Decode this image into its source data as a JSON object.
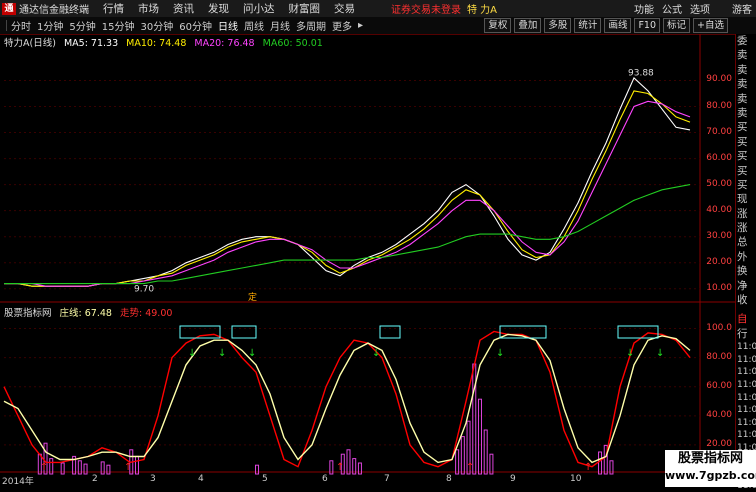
{
  "titlebar": {
    "app_title": "通达信金融终端",
    "menu": [
      "行情",
      "市场",
      "资讯",
      "发现",
      "问小达",
      "财富圈",
      "交易"
    ],
    "status": "证券交易未登录",
    "stock_name": "特 力A",
    "right_menu": [
      "功能",
      "公式",
      "选项",
      "游客"
    ]
  },
  "toolbar": {
    "periods": [
      "分时",
      "1分钟",
      "5分钟",
      "15分钟",
      "30分钟",
      "60分钟",
      "日线",
      "周线",
      "月线",
      "多周期",
      "更多"
    ],
    "active_period": "日线",
    "right_buttons": [
      "复权",
      "叠加",
      "多股",
      "统计",
      "画线",
      "F10",
      "标记",
      "+自选"
    ]
  },
  "main_chart": {
    "legend": {
      "name": "特力A(日线)",
      "ma5": "MA5: 71.33",
      "ma10": "MA10: 74.48",
      "ma20": "MA20: 76.48",
      "ma60": "MA60: 50.01"
    },
    "price_high_label": "93.88",
    "price_low_label": "9.70",
    "marker_label": "定",
    "y_ticks": [
      "90.00",
      "80.00",
      "70.00",
      "60.00",
      "50.00",
      "40.00",
      "30.00",
      "20.00",
      "10.00"
    ],
    "ylim": [
      8,
      104
    ]
  },
  "sub_chart": {
    "legend": {
      "name": "股票指标网",
      "zhuangxian": "庄线: 67.48",
      "zoushi": "走势: 49.00"
    },
    "y_ticks": [
      "100.0",
      "80.00",
      "60.00",
      "40.00",
      "20.00"
    ],
    "ylim": [
      0,
      110
    ]
  },
  "x_axis": {
    "labels": [
      "2014年",
      "2",
      "3",
      "4",
      "5",
      "6",
      "7",
      "8",
      "9",
      "10"
    ]
  },
  "right_panel": {
    "items": [
      "委比",
      "卖五",
      "卖四",
      "卖三",
      "卖二",
      "卖一",
      "买一",
      "买二",
      "买三",
      "买四",
      "买五",
      "现价",
      "涨跌",
      "涨幅",
      "总量",
      "外盘",
      "换手",
      "净资",
      "收益"
    ],
    "section_title": "自动",
    "section_sub": "行情",
    "times": [
      "11:08",
      "11:08",
      "11:08",
      "11:08",
      "11:08",
      "11:09",
      "11:09",
      "11:09",
      "11:09",
      "11:09",
      "11:09",
      "11:09"
    ]
  },
  "watermark": {
    "line1": "股票指标网",
    "line2": "www.7gpzb.com"
  },
  "chart_data": {
    "type": "line",
    "title": "特力A(日线)",
    "price_series": [
      {
        "name": "MA5",
        "color": "#ffffff",
        "values": [
          12,
          12,
          11,
          11,
          11,
          11,
          11,
          12,
          12,
          13,
          14,
          15,
          17,
          20,
          22,
          24,
          27,
          29,
          30,
          30,
          29,
          27,
          22,
          17,
          15,
          19,
          22,
          24,
          27,
          31,
          35,
          40,
          47,
          50,
          46,
          38,
          29,
          23,
          21,
          24,
          33,
          43,
          55,
          66,
          79,
          91,
          86,
          79,
          72,
          71
        ]
      },
      {
        "name": "MA10",
        "color": "#ffee00",
        "values": [
          12,
          12,
          11,
          11,
          11,
          11,
          11,
          12,
          12,
          13,
          13,
          15,
          16,
          19,
          21,
          23,
          26,
          28,
          29,
          30,
          29,
          27,
          24,
          19,
          16,
          18,
          21,
          23,
          26,
          29,
          33,
          38,
          44,
          48,
          46,
          40,
          32,
          25,
          22,
          23,
          30,
          40,
          52,
          63,
          75,
          86,
          85,
          81,
          76,
          74
        ]
      },
      {
        "name": "MA20",
        "color": "#ff44ff",
        "values": [
          12,
          12,
          12,
          11,
          11,
          11,
          11,
          12,
          12,
          12,
          13,
          14,
          15,
          17,
          19,
          21,
          24,
          26,
          28,
          29,
          29,
          27,
          25,
          21,
          18,
          18,
          20,
          22,
          24,
          27,
          31,
          35,
          40,
          44,
          44,
          40,
          34,
          28,
          24,
          23,
          28,
          36,
          47,
          58,
          69,
          80,
          82,
          81,
          78,
          76
        ]
      },
      {
        "name": "MA60",
        "color": "#22cc22",
        "values": [
          12,
          12,
          12,
          12,
          12,
          12,
          12,
          12,
          12,
          12,
          12,
          13,
          13,
          14,
          15,
          16,
          17,
          18,
          19,
          20,
          21,
          21,
          21,
          21,
          21,
          21,
          22,
          22,
          23,
          24,
          25,
          26,
          28,
          30,
          31,
          31,
          31,
          30,
          29,
          29,
          30,
          32,
          35,
          38,
          41,
          44,
          46,
          48,
          49,
          50
        ]
      }
    ],
    "indicator_series": [
      {
        "name": "庄线",
        "color": "#ff0000",
        "values": [
          60,
          40,
          20,
          8,
          8,
          10,
          12,
          18,
          15,
          8,
          10,
          40,
          80,
          90,
          95,
          96,
          92,
          80,
          70,
          40,
          10,
          5,
          30,
          60,
          80,
          92,
          90,
          80,
          55,
          20,
          8,
          5,
          10,
          50,
          92,
          98,
          96,
          96,
          92,
          70,
          30,
          8,
          5,
          12,
          60,
          90,
          97,
          96,
          92,
          80
        ]
      },
      {
        "name": "走势",
        "color": "#ffffaa",
        "values": [
          50,
          45,
          30,
          15,
          10,
          10,
          12,
          15,
          15,
          12,
          12,
          25,
          50,
          75,
          88,
          92,
          92,
          85,
          75,
          55,
          25,
          10,
          20,
          45,
          68,
          85,
          90,
          85,
          65,
          35,
          15,
          8,
          10,
          35,
          75,
          92,
          96,
          95,
          92,
          78,
          45,
          18,
          8,
          12,
          40,
          75,
          92,
          95,
          93,
          85
        ]
      }
    ],
    "volume_bars": [
      {
        "x": 6,
        "v": 18
      },
      {
        "x": 7,
        "v": 28
      },
      {
        "x": 8,
        "v": 14
      },
      {
        "x": 10,
        "v": 10
      },
      {
        "x": 12,
        "v": 16
      },
      {
        "x": 13,
        "v": 12
      },
      {
        "x": 14,
        "v": 9
      },
      {
        "x": 17,
        "v": 11
      },
      {
        "x": 18,
        "v": 8
      },
      {
        "x": 22,
        "v": 22
      },
      {
        "x": 23,
        "v": 16
      },
      {
        "x": 44,
        "v": 8
      },
      {
        "x": 57,
        "v": 12
      },
      {
        "x": 59,
        "v": 18
      },
      {
        "x": 60,
        "v": 22
      },
      {
        "x": 61,
        "v": 14
      },
      {
        "x": 62,
        "v": 10
      },
      {
        "x": 79,
        "v": 22
      },
      {
        "x": 80,
        "v": 34
      },
      {
        "x": 81,
        "v": 48
      },
      {
        "x": 82,
        "v": 100
      },
      {
        "x": 83,
        "v": 68
      },
      {
        "x": 84,
        "v": 40
      },
      {
        "x": 85,
        "v": 18
      },
      {
        "x": 104,
        "v": 20
      },
      {
        "x": 105,
        "v": 26
      },
      {
        "x": 106,
        "v": 12
      }
    ]
  }
}
